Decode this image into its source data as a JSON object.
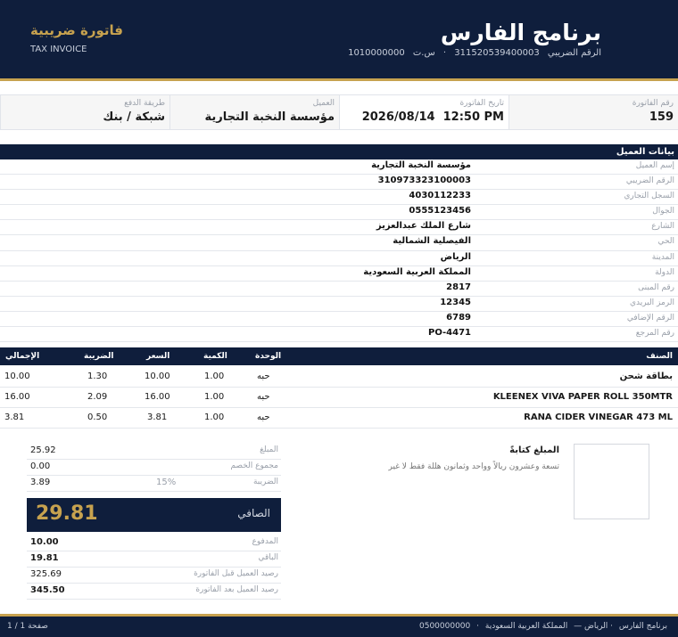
{
  "header": {
    "company_name": "برنامج الفارس",
    "tax_label": "الرقم الضريبي",
    "tax_number": "311520539400003",
    "cr_label": "س.ت",
    "cr_number": "1010000000",
    "separator": "·",
    "invoice_title": "فاتورة ضريبية",
    "invoice_title_en": "TAX INVOICE"
  },
  "info": {
    "invoice_no_label": "رقم الفاتورة",
    "invoice_no": "159",
    "date_label": "تاريخ الفاتورة",
    "date": "2026/08/14  12:50 PM",
    "customer_label": "العميل",
    "customer": "مؤسسة النخبة التجارية",
    "payment_label": "طريقة الدفع",
    "payment": "شبكة / بنك"
  },
  "customer_section": {
    "title": "بيانات العميل",
    "rows": [
      {
        "label": "إسم العميل",
        "value": "مؤسسة النخبة التجارية"
      },
      {
        "label": "الرقم الضريبي",
        "value": "310973323100003"
      },
      {
        "label": "السجل التجاري",
        "value": "4030112233"
      },
      {
        "label": "الجوال",
        "value": "0555123456"
      },
      {
        "label": "الشارع",
        "value": "شارع الملك عبدالعزيز"
      },
      {
        "label": "الحي",
        "value": "الفيصلية الشمالية"
      },
      {
        "label": "المدينة",
        "value": "الرياض"
      },
      {
        "label": "الدولة",
        "value": "المملكة العربية السعودية"
      },
      {
        "label": "رقم المبنى",
        "value": "2817"
      },
      {
        "label": "الرمز البريدي",
        "value": "12345"
      },
      {
        "label": "الرقم الإضافي",
        "value": "6789"
      },
      {
        "label": "رقم المرجع",
        "value": "PO-4471"
      }
    ]
  },
  "items": {
    "columns": {
      "item": "الصنف",
      "unit": "الوحدة",
      "qty": "الكمية",
      "price": "السعر",
      "tax": "الضريبة",
      "total": "الإجمالي"
    },
    "rows": [
      {
        "name": "بطاقة شحن",
        "unit": "حبه",
        "qty": "1.00",
        "price": "10.00",
        "tax": "1.30",
        "total": "10.00"
      },
      {
        "name": "KLEENEX VIVA PAPER ROLL 350MTR",
        "unit": "حبه",
        "qty": "1.00",
        "price": "16.00",
        "tax": "2.09",
        "total": "16.00"
      },
      {
        "name": "RANA CIDER VINEGAR 473 ML",
        "unit": "حبه",
        "qty": "1.00",
        "price": "3.81",
        "tax": "0.50",
        "total": "3.81"
      }
    ]
  },
  "amount_words": {
    "title": "المبلغ كتابةً",
    "text": "تسعة وعشرون ريالاً وواحد وثمانون هللة فقط لا غير"
  },
  "totals": {
    "amount_label": "المبلغ",
    "amount": "25.92",
    "discount_label": "مجموع الخصم",
    "discount": "0.00",
    "tax_label": "الضريبة",
    "tax": "3.89",
    "tax_rate": "15%",
    "net_label": "الصافي",
    "net": "29.81",
    "paid_label": "المدفوع",
    "paid": "10.00",
    "remaining_label": "الباقي",
    "remaining": "19.81",
    "balance_before_label": "رصيد العميل قبل الفاتورة",
    "balance_before": "325.69",
    "balance_after_label": "رصيد العميل بعد الفاتورة",
    "balance_after": "345.50"
  },
  "footer": {
    "company": "برنامج الفارس",
    "city": "· الرياض —",
    "country": "المملكة العربية السعودية",
    "sep": "·",
    "phone": "0500000000",
    "page": "صفحة 1 / 1"
  },
  "colors": {
    "navy": "#0f1e3c",
    "gold": "#c7a24f"
  }
}
